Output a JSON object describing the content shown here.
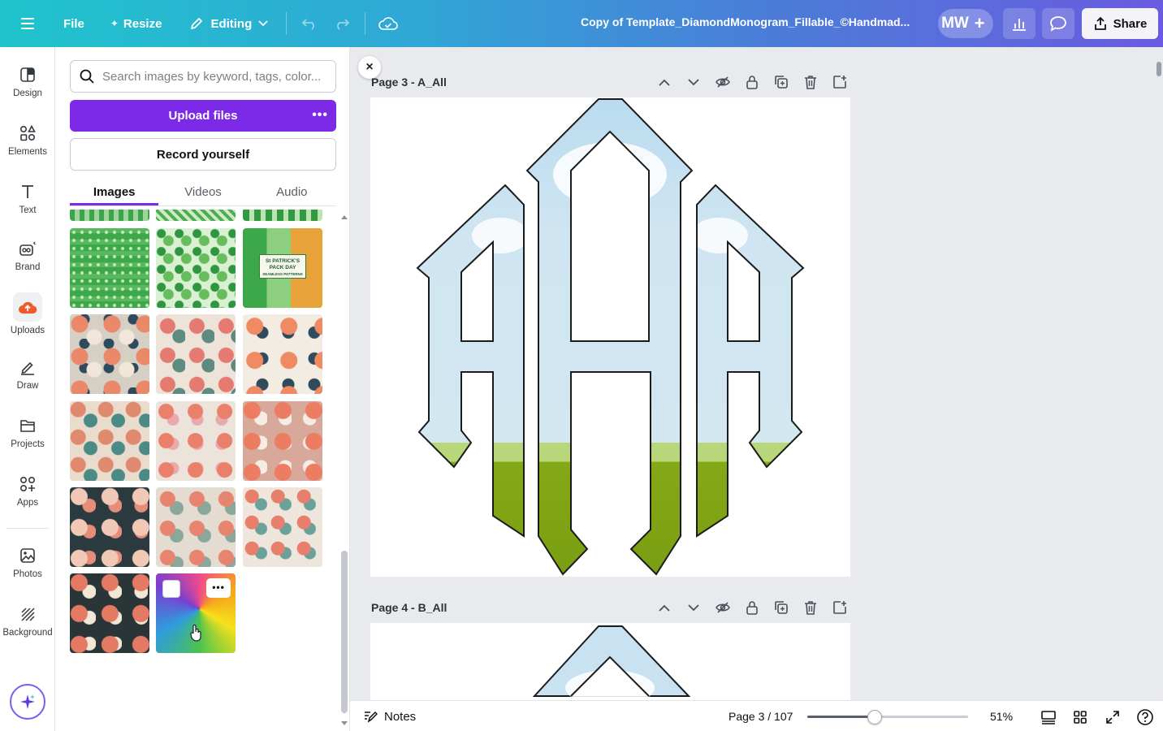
{
  "topbar": {
    "file_label": "File",
    "resize_label": "Resize",
    "editing_label": "Editing",
    "doc_title": "Copy of Template_DiamondMonogram_Fillable_©Handmad...",
    "avatar_initials": "MW",
    "share_label": "Share",
    "gradient_start": "#20c4cc",
    "gradient_end": "#6a5be0"
  },
  "rail": {
    "items": [
      {
        "label": "Design",
        "icon": "design-icon"
      },
      {
        "label": "Elements",
        "icon": "elements-icon"
      },
      {
        "label": "Text",
        "icon": "text-icon"
      },
      {
        "label": "Brand",
        "icon": "brand-icon"
      },
      {
        "label": "Uploads",
        "icon": "uploads-icon"
      },
      {
        "label": "Draw",
        "icon": "draw-icon"
      },
      {
        "label": "Projects",
        "icon": "projects-icon"
      },
      {
        "label": "Apps",
        "icon": "apps-icon"
      },
      {
        "label": "Photos",
        "icon": "photos-icon"
      },
      {
        "label": "Background",
        "icon": "background-icon"
      }
    ],
    "active": "Uploads"
  },
  "panel": {
    "search_placeholder": "Search images by keyword, tags, color...",
    "upload_label": "Upload files",
    "record_label": "Record yourself",
    "tabs": [
      "Images",
      "Videos",
      "Audio"
    ],
    "active_tab": "Images",
    "accent": "#7d2ae8",
    "thumb_top_text": "St PATRICK'S PACK DAY",
    "thumb_sub_text": "SEAMLESS PATTERNS"
  },
  "canvas": {
    "page3_label": "Page 3 - A_All",
    "page4_label": "Page 4 - B_All",
    "sky_color": "#c8e2f1",
    "grass_color": "#84a816",
    "grass_light": "#b7d77a"
  },
  "bottombar": {
    "notes_label": "Notes",
    "page_indicator": "Page 3 / 107",
    "zoom_label": "51%",
    "zoom_fraction": 0.42
  }
}
